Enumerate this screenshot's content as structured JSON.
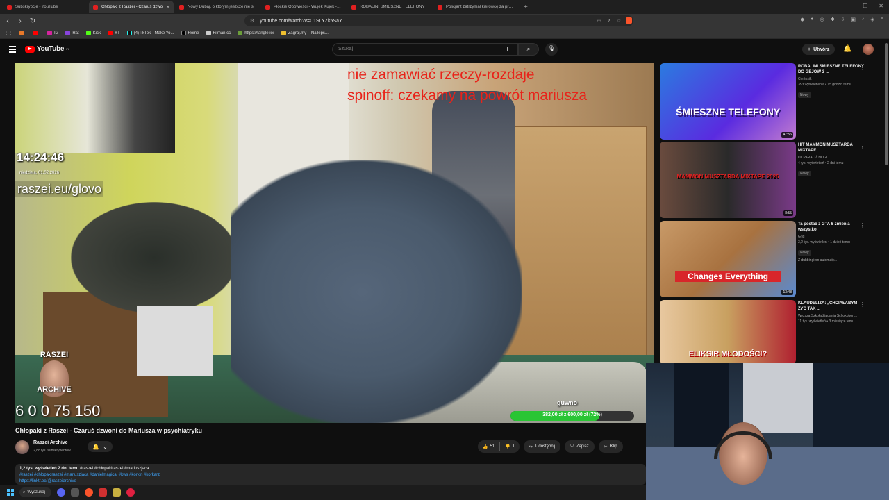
{
  "browser": {
    "tabs": [
      {
        "title": "Subskrypcje - YouTube",
        "active": false
      },
      {
        "title": "Chłopaki z Raszei - Czaruś dzwo",
        "active": true
      },
      {
        "title": "Nowy Dubaj, o którym jeszcze nie sł",
        "active": false
      },
      {
        "title": "Płockie Opowieści - Wujek Kujek - Yo",
        "active": false
      },
      {
        "title": "ROBALINI ŚMIESZNE TELEFONY",
        "active": false
      },
      {
        "title": "Policjant zatrzymał kierowcę za prędk",
        "active": false
      }
    ],
    "tab_close": "×",
    "new_tab": "+",
    "url": "youtube.com/watch?v=C1SLYZk5SaY",
    "bookmarks": [
      "",
      "",
      "IG",
      "Rat",
      "Kick",
      "YT",
      "(4)TikTok - Make Yo...",
      "Home",
      "Filman.cc",
      "https://tangle.io/",
      "Zagraj.my – Najleps..."
    ]
  },
  "youtube": {
    "logo_text": "YouTube",
    "region": "PL",
    "search_placeholder": "Szukaj",
    "create_label": "Utwórz"
  },
  "video": {
    "overlay_line1": "nie zamawiać rzeczy-rozdaje",
    "overlay_line2": "spinoff: czekamy na powrót mariusza",
    "clock": "14:24:46",
    "date": "niedziela, 01.02.2026",
    "site": "raszei.eu/glovo",
    "badge_top": "RASZEI",
    "badge_bottom": "ARCHIVE",
    "big_number": "6 0 0 75 150",
    "goal_label": "guwno",
    "goal_text": "382,00 zł z 600,00 zł (72%)",
    "goal_fraction": 0.72,
    "title": "Chłopaki z Raszei - Czaruś dzwoni do Mariusza w psychiatryku"
  },
  "channel": {
    "name": "Raszei Archive",
    "subs": "2,88 tys. subskrybentów"
  },
  "actions": {
    "likes": "51",
    "dislikes": "1",
    "share": "Udostępnij",
    "save": "Zapisz",
    "clip": "Klip"
  },
  "description": {
    "meta": "1,2 tys. wyświetleń  2 dni temu",
    "tags1": "#raszei #chłopakiraszei #mariuszjaca",
    "tags2": "#raszei #chłopakiraszei #mariuszjaca #danielmagical #kws #korkin #korkarz",
    "line3": "https://linktr.ee/@raszeiarchive"
  },
  "recommendations": [
    {
      "title": "ROBALINI ŚMIESZNE TELEFONY DO GEJÓW 3 ...",
      "channel": "Centosik",
      "views": "353 wyświetlenia • 15 godzin temu",
      "badge": "Nowy",
      "duration": "47:56",
      "caption": "ŚMIESZNE TELEFONY"
    },
    {
      "title": "HIT MAMMON MUSZTARDA MIXTAPE ...",
      "channel": "DJ PARALIŻ NOGI",
      "views": "4 tys. wyświetleń • 2 dni temu",
      "badge": "Nowy",
      "duration": "8:55",
      "caption": "MAMMON MUSZTARDA MIXTAPE 2026"
    },
    {
      "title": "Ta postać z GTA 6 zmienia wszystko",
      "channel": "Grid",
      "views": "3,2 tys. wyświetleń • 1 dzień temu",
      "badge": "Nowy",
      "extra": "Z dubbingiem automaty...",
      "duration": "13:48",
      "caption": "Changes Everything"
    },
    {
      "title": "KLAUDELIZA: „CHCIAŁABYM ŻYĆ TAK ...",
      "channel": "Wyższa Szkoła Zjadania Schokobon...",
      "views": "11 tys. wyświetleń • 3 miesiące temu",
      "badge": "",
      "duration": "",
      "caption": "ELIKSIR MŁODOŚCI?"
    }
  ],
  "taskbar": {
    "search_label": "Wyszukaj"
  },
  "colors": {
    "yt_red": "#ff0000",
    "goal_green": "#29c534",
    "overlay_red": "#e8231a",
    "link_blue": "#3ea6ff"
  }
}
